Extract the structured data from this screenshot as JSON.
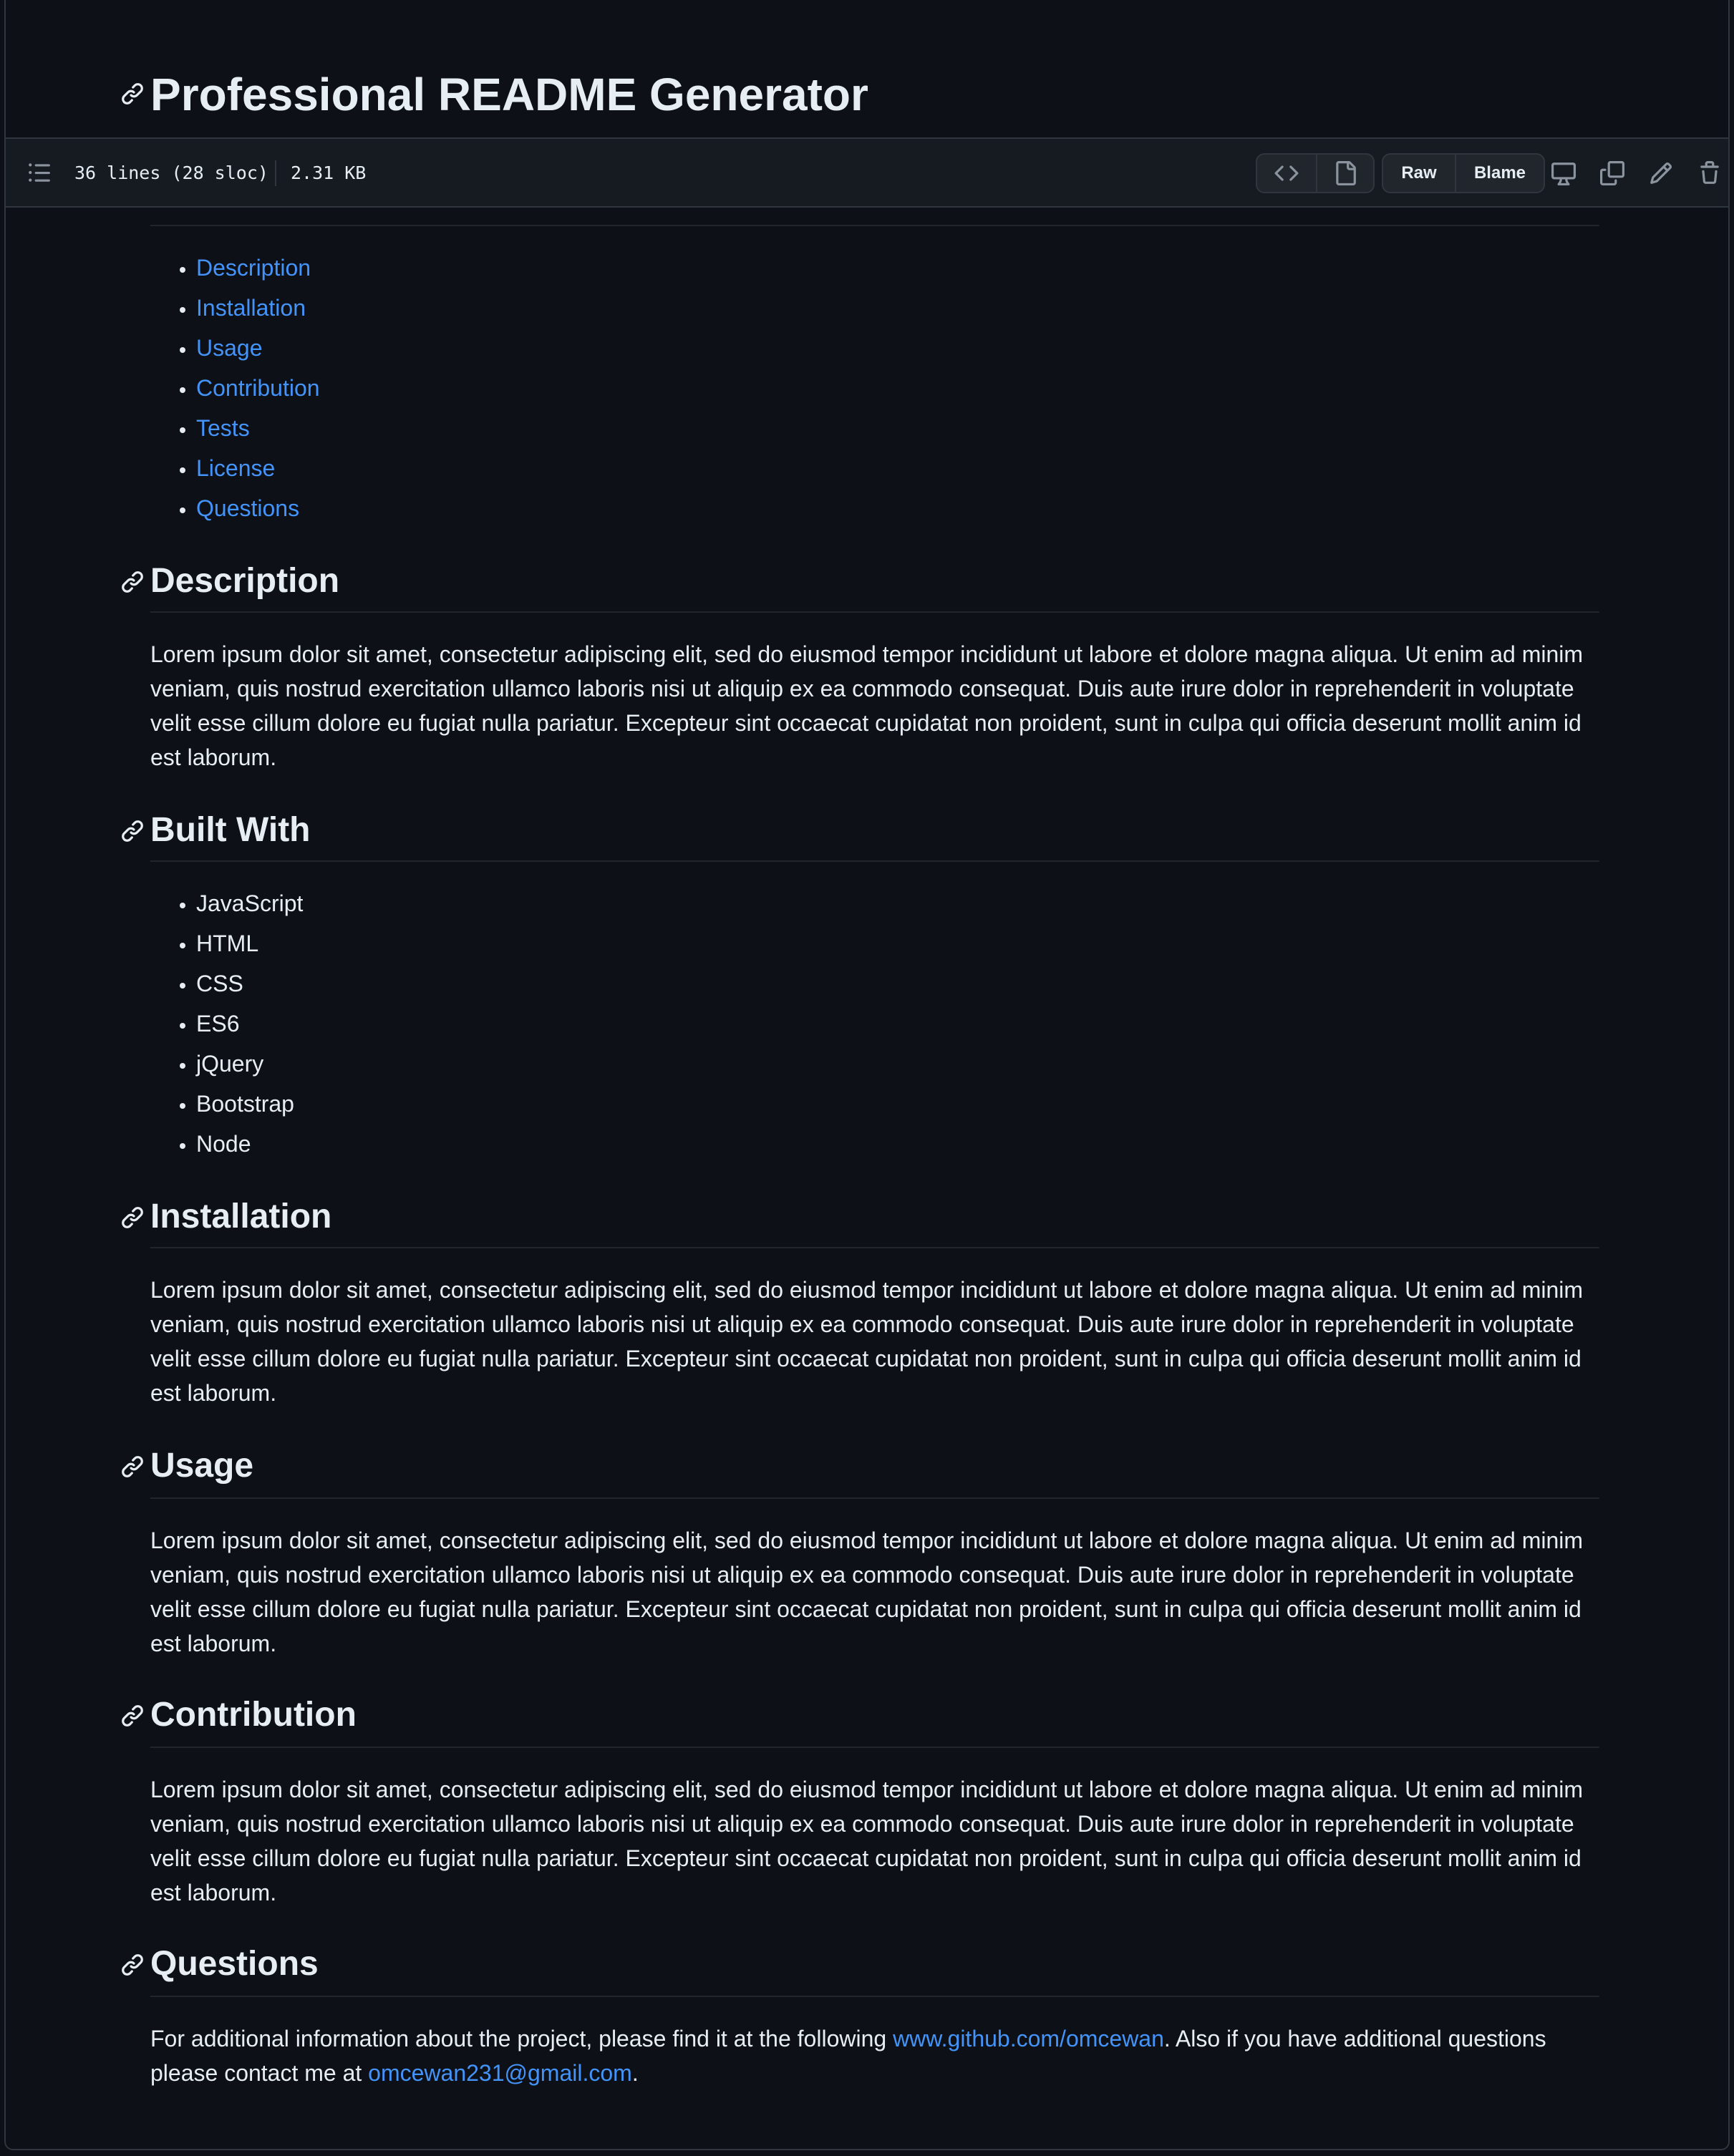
{
  "title": "Professional README Generator",
  "toolbar": {
    "lines_info": "36 lines (28 sloc)",
    "size": "2.31 KB",
    "raw_label": "Raw",
    "blame_label": "Blame"
  },
  "toc": [
    {
      "label": "Description"
    },
    {
      "label": "Installation"
    },
    {
      "label": "Usage"
    },
    {
      "label": "Contribution"
    },
    {
      "label": "Tests"
    },
    {
      "label": "License"
    },
    {
      "label": "Questions"
    }
  ],
  "sections": {
    "description": {
      "heading": "Description",
      "body": "Lorem ipsum dolor sit amet, consectetur adipiscing elit, sed do eiusmod tempor incididunt ut labore et dolore magna aliqua. Ut enim ad minim veniam, quis nostrud exercitation ullamco laboris nisi ut aliquip ex ea commodo consequat. Duis aute irure dolor in reprehenderit in voluptate velit esse cillum dolore eu fugiat nulla pariatur. Excepteur sint occaecat cupidatat non proident, sunt in culpa qui officia deserunt mollit anim id est laborum."
    },
    "built_with": {
      "heading": "Built With",
      "items": [
        "JavaScript",
        "HTML",
        "CSS",
        "ES6",
        "jQuery",
        "Bootstrap",
        "Node"
      ]
    },
    "installation": {
      "heading": "Installation",
      "body": "Lorem ipsum dolor sit amet, consectetur adipiscing elit, sed do eiusmod tempor incididunt ut labore et dolore magna aliqua. Ut enim ad minim veniam, quis nostrud exercitation ullamco laboris nisi ut aliquip ex ea commodo consequat. Duis aute irure dolor in reprehenderit in voluptate velit esse cillum dolore eu fugiat nulla pariatur. Excepteur sint occaecat cupidatat non proident, sunt in culpa qui officia deserunt mollit anim id est laborum."
    },
    "usage": {
      "heading": "Usage",
      "body": "Lorem ipsum dolor sit amet, consectetur adipiscing elit, sed do eiusmod tempor incididunt ut labore et dolore magna aliqua. Ut enim ad minim veniam, quis nostrud exercitation ullamco laboris nisi ut aliquip ex ea commodo consequat. Duis aute irure dolor in reprehenderit in voluptate velit esse cillum dolore eu fugiat nulla pariatur. Excepteur sint occaecat cupidatat non proident, sunt in culpa qui officia deserunt mollit anim id est laborum."
    },
    "contribution": {
      "heading": "Contribution",
      "body": "Lorem ipsum dolor sit amet, consectetur adipiscing elit, sed do eiusmod tempor incididunt ut labore et dolore magna aliqua. Ut enim ad minim veniam, quis nostrud exercitation ullamco laboris nisi ut aliquip ex ea commodo consequat. Duis aute irure dolor in reprehenderit in voluptate velit esse cillum dolore eu fugiat nulla pariatur. Excepteur sint occaecat cupidatat non proident, sunt in culpa qui officia deserunt mollit anim id est laborum."
    },
    "questions": {
      "heading": "Questions",
      "body_before": "For additional information about the project, please find it at the following ",
      "github_link": "www.github.com/omcewan",
      "body_middle": ". Also if you have additional questions please contact me at ",
      "email_link": "omcewan231@gmail.com",
      "body_after": "."
    }
  },
  "colors": {
    "background": "#0d1117",
    "toolbar": "#161b22",
    "text": "#e6edf3",
    "link": "#4493f8",
    "border": "#30363d"
  }
}
